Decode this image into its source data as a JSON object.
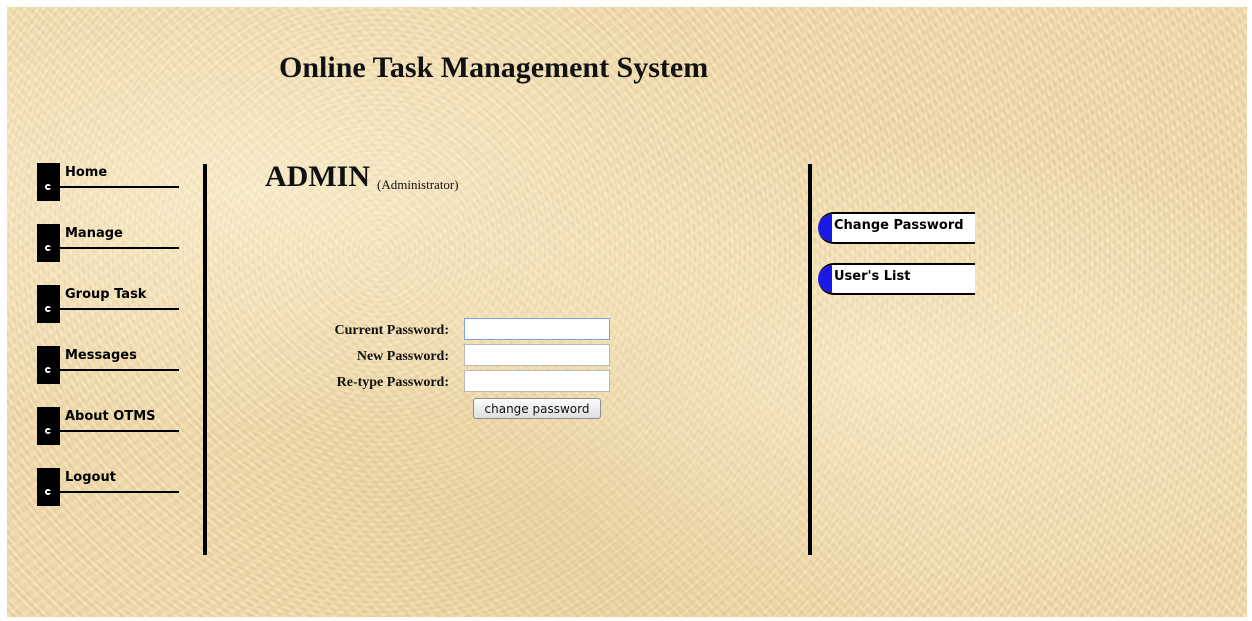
{
  "header": {
    "title": "Online Task Management System"
  },
  "nav": {
    "items": [
      {
        "label": "Home"
      },
      {
        "label": "Manage"
      },
      {
        "label": "Group Task"
      },
      {
        "label": "Messages"
      },
      {
        "label": "About OTMS"
      },
      {
        "label": "Logout"
      }
    ]
  },
  "user": {
    "name": "ADMIN",
    "role": "(Administrator)"
  },
  "form": {
    "current_label": "Current Password:",
    "current_value": "",
    "new_label": "New Password:",
    "new_value": "",
    "retype_label": "Re-type Password:",
    "retype_value": "",
    "submit_label": "change password"
  },
  "side_links": [
    {
      "label": "Change Password"
    },
    {
      "label": "User's List"
    }
  ],
  "colors": {
    "background": "#efd9a8",
    "link_cap": "#1a1ae6",
    "text": "#111111"
  }
}
